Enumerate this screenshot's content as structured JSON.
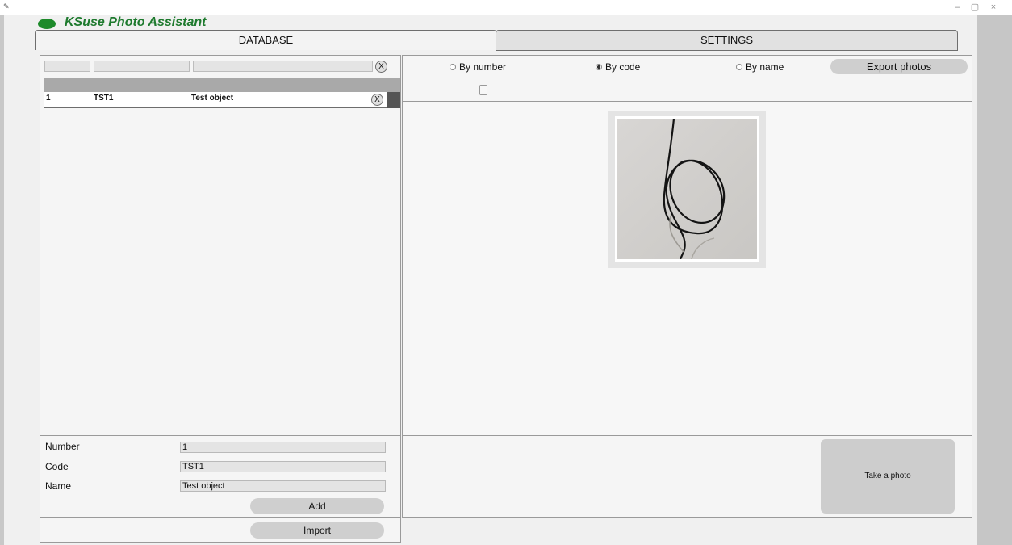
{
  "app": {
    "title": "KSuse Photo Assistant",
    "logo_color": "#1d8a2a",
    "title_color": "#1e7a2e"
  },
  "window_controls": {
    "minimize": "–",
    "maximize": "▢",
    "close": "×"
  },
  "tabs": [
    {
      "label": "DATABASE",
      "active": true
    },
    {
      "label": "SETTINGS",
      "active": false
    }
  ],
  "filters": {
    "clear_label": "X"
  },
  "table": {
    "rows": [
      {
        "number": "1",
        "code": "TST1",
        "name": "Test object",
        "delete_label": "X"
      }
    ]
  },
  "sort": {
    "options": [
      {
        "label": "By number",
        "checked": false
      },
      {
        "label": "By code",
        "checked": true
      },
      {
        "label": "By name",
        "checked": false
      }
    ],
    "export_label": "Export photos"
  },
  "form": {
    "number_label": "Number",
    "number_value": "1",
    "code_label": "Code",
    "code_value": "TST1",
    "name_label": "Name",
    "name_value": "Test object",
    "add_label": "Add",
    "import_label": "Import"
  },
  "capture": {
    "take_photo_label": "Take a photo"
  }
}
